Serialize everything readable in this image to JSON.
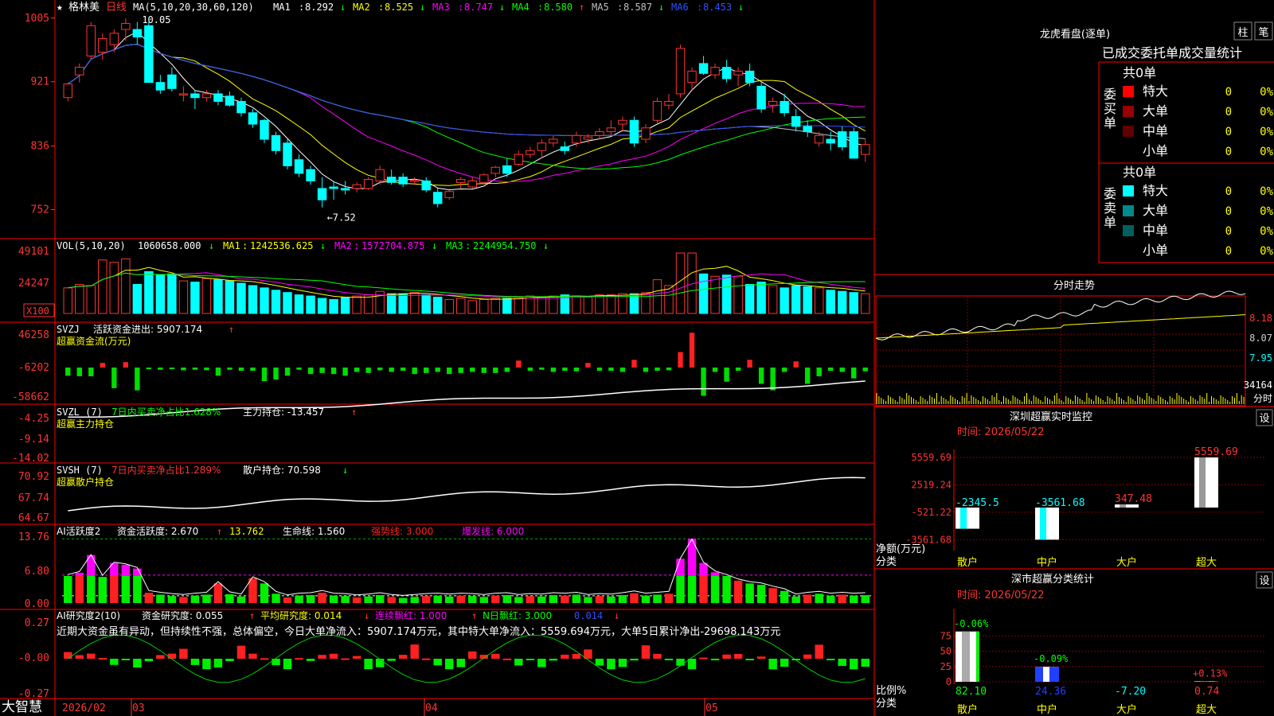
{
  "stock": {
    "star": "★",
    "name": "格林美",
    "period": "日线"
  },
  "ma_header": {
    "label": "MA(5,10,20,30,60,120)",
    "items": [
      {
        "name": "MA1",
        "value": "8.292",
        "arrow": "↓",
        "color": "#ffffff"
      },
      {
        "name": "MA2",
        "value": "8.525",
        "arrow": "↓",
        "color": "#ffff00"
      },
      {
        "name": "MA3",
        "value": "8.747",
        "arrow": "↓",
        "color": "#ff00ff"
      },
      {
        "name": "MA4",
        "value": "8.580",
        "arrow": "↑",
        "color": "#00ff00"
      },
      {
        "name": "MA5",
        "value": "8.587",
        "arrow": "↓",
        "color": "#c0c0c0"
      },
      {
        "name": "MA6",
        "value": "8.453",
        "arrow": "↓",
        "color": "#3050ff"
      }
    ]
  },
  "main_axis": {
    "ticks": [
      "1005",
      "921",
      "836",
      "752"
    ]
  },
  "main_annotations": {
    "high": "10.05",
    "low": "←7.52"
  },
  "vol": {
    "label": "VOL(5,10,20)",
    "value": "1060658.000",
    "arrow": "↓",
    "ma": [
      {
        "name": "MA1",
        "value": "1242536.625",
        "arrow": "↓",
        "color": "#ffff00"
      },
      {
        "name": "MA2",
        "value": "1572704.875",
        "arrow": "↓",
        "color": "#ff00ff"
      },
      {
        "name": "MA3",
        "value": "2244954.750",
        "arrow": "↓",
        "color": "#00ff00"
      }
    ],
    "ticks": [
      "49101",
      "24247"
    ],
    "unit": "X100"
  },
  "svzj": {
    "label": "SVZJ",
    "text": "活跃资金进出: 5907.174",
    "arrow": "↑",
    "sub": "超赢资金流(万元)",
    "ticks": [
      "46258",
      "-6202",
      "-58662"
    ]
  },
  "svzl": {
    "label": "SVZL (7)",
    "text1": "7日内买卖净占比1.628%",
    "text2": "主力持仓: -13.457",
    "arrow": "↑",
    "sub": "超赢主力持仓",
    "ticks": [
      "-4.25",
      "-9.14",
      "-14.02"
    ]
  },
  "svsh": {
    "label": "SVSH (7)",
    "text1": "7日内买卖净占比1.289%",
    "text2": "散户持仓: 70.598",
    "arrow": "↓",
    "sub": "超赢散户持仓",
    "ticks": [
      "70.92",
      "67.74",
      "64.67"
    ]
  },
  "ai2": {
    "label": "AI活跃度2",
    "t1": "资金活跃度: 2.670",
    "a1": "↑",
    "t2": "13.762",
    "t3": "生命线: 1.560",
    "t4": "强势线: 3.000",
    "t5": "爆发线: 6.000",
    "ticks": [
      "13.76",
      "6.80",
      "0.00"
    ]
  },
  "ai3": {
    "label": "AI研究度2(10)",
    "t1": "资金研究度: 0.055",
    "a1": "↑",
    "t2": "平均研究度: 0.014",
    "a2": "↓",
    "t3": "连续飘红: 1.000",
    "a3": "↑",
    "t4": "N日飘红: 3.000",
    "t5": "0.014",
    "a5": "↓",
    "ticks": [
      "0.27",
      "-0.00",
      "-0.27"
    ],
    "comment": "近期大资金虽有异动，但持续性不强，总体偏空，今日大单净流入：5907.174万元，其中特大单净流入：5559.694万元，大单5日累计净出-29698.143万元"
  },
  "x_axis": {
    "labels": [
      "2026/02",
      "03",
      "04",
      "05"
    ]
  },
  "brand": "大智慧",
  "longhu": {
    "title": "龙虎看盘(逐单)",
    "btn1": "柱",
    "btn2": "笔",
    "header": "已成交委托单成交量统计",
    "buy_label": "委买单",
    "sell_label": "委卖单",
    "buy_total": "共0单",
    "sell_total": "共0单",
    "buy_rows": [
      {
        "name": "特大",
        "count": "0",
        "pct": "0%",
        "color": "#ff0000"
      },
      {
        "name": "大单",
        "count": "0",
        "pct": "0%",
        "color": "#9a0000"
      },
      {
        "name": "中单",
        "count": "0",
        "pct": "0%",
        "color": "#600000"
      },
      {
        "name": "小单",
        "count": "0",
        "pct": "0%",
        "color": "#000000"
      }
    ],
    "sell_rows": [
      {
        "name": "特大",
        "count": "0",
        "pct": "0%",
        "color": "#00ffff"
      },
      {
        "name": "大单",
        "count": "0",
        "pct": "0%",
        "color": "#008b8b"
      },
      {
        "name": "中单",
        "count": "0",
        "pct": "0%",
        "color": "#006060"
      },
      {
        "name": "小单",
        "count": "0",
        "pct": "0%",
        "color": "#000000"
      }
    ]
  },
  "intraday": {
    "title": "分时走势",
    "ticks": [
      "8.18",
      "8.07",
      "7.95"
    ],
    "vol_label": "34164",
    "vol_unit": "分时"
  },
  "monitor": {
    "title": "深圳超赢实时监控",
    "btn": "设",
    "time": "时间: 2026/05/22",
    "ylabel": "净额(万元)",
    "xlabel": "分类"
  },
  "classify": {
    "title": "深市超赢分类统计",
    "btn": "设",
    "time": "时间: 2026/05/22",
    "ylabel": "比例%",
    "xlabel": "分类"
  },
  "chart_data": [
    {
      "type": "candlestick",
      "title": "格林美 日线",
      "ylim": [
        7.4,
        10.1
      ],
      "ohlc": [
        [
          9.0,
          9.2,
          8.95,
          9.18
        ],
        [
          9.3,
          9.45,
          9.2,
          9.4
        ],
        [
          9.55,
          10.0,
          9.5,
          9.95
        ],
        [
          9.6,
          9.85,
          9.5,
          9.78
        ],
        [
          9.7,
          9.9,
          9.6,
          9.85
        ],
        [
          9.9,
          10.05,
          9.75,
          9.98
        ],
        [
          9.9,
          10.0,
          9.7,
          9.8
        ],
        [
          9.95,
          10.0,
          9.2,
          9.2
        ],
        [
          9.2,
          9.3,
          9.05,
          9.1
        ],
        [
          9.3,
          9.4,
          9.08,
          9.12
        ],
        [
          9.05,
          9.15,
          8.95,
          9.05
        ],
        [
          9.05,
          9.1,
          8.85,
          9.0
        ],
        [
          9.0,
          9.1,
          8.95,
          9.05
        ],
        [
          9.05,
          9.1,
          8.9,
          8.95
        ],
        [
          9.02,
          9.08,
          8.88,
          8.9
        ],
        [
          8.95,
          9.0,
          8.75,
          8.8
        ],
        [
          8.8,
          8.85,
          8.6,
          8.65
        ],
        [
          8.7,
          8.72,
          8.4,
          8.45
        ],
        [
          8.5,
          8.55,
          8.25,
          8.3
        ],
        [
          8.4,
          8.45,
          8.05,
          8.1
        ],
        [
          8.18,
          8.25,
          7.95,
          8.0
        ],
        [
          8.05,
          8.1,
          7.85,
          7.9
        ],
        [
          7.8,
          7.95,
          7.55,
          7.65
        ],
        [
          7.82,
          7.9,
          7.65,
          7.8
        ],
        [
          7.8,
          7.9,
          7.72,
          7.78
        ],
        [
          7.8,
          7.88,
          7.75,
          7.85
        ],
        [
          7.8,
          7.95,
          7.78,
          7.92
        ],
        [
          7.9,
          8.1,
          7.85,
          8.05
        ],
        [
          7.95,
          8.05,
          7.85,
          7.88
        ],
        [
          7.95,
          8.0,
          7.82,
          7.86
        ],
        [
          7.9,
          7.95,
          7.85,
          7.91
        ],
        [
          7.9,
          7.95,
          7.75,
          7.78
        ],
        [
          7.75,
          7.8,
          7.55,
          7.6
        ],
        [
          7.68,
          7.8,
          7.65,
          7.76
        ],
        [
          7.88,
          7.95,
          7.8,
          7.92
        ],
        [
          7.82,
          7.95,
          7.8,
          7.9
        ],
        [
          7.88,
          8.0,
          7.85,
          7.98
        ],
        [
          8.0,
          8.1,
          7.95,
          8.08
        ],
        [
          8.1,
          8.2,
          7.95,
          8.0
        ],
        [
          8.12,
          8.3,
          8.1,
          8.25
        ],
        [
          8.25,
          8.35,
          8.2,
          8.3
        ],
        [
          8.3,
          8.45,
          8.2,
          8.4
        ],
        [
          8.4,
          8.5,
          8.35,
          8.45
        ],
        [
          8.35,
          8.42,
          8.25,
          8.3
        ],
        [
          8.4,
          8.55,
          8.35,
          8.5
        ],
        [
          8.45,
          8.52,
          8.4,
          8.48
        ],
        [
          8.5,
          8.6,
          8.45,
          8.55
        ],
        [
          8.55,
          8.7,
          8.5,
          8.6
        ],
        [
          8.65,
          8.75,
          8.55,
          8.7
        ],
        [
          8.7,
          8.75,
          8.35,
          8.4
        ],
        [
          8.45,
          8.65,
          8.4,
          8.6
        ],
        [
          8.7,
          9.0,
          8.65,
          8.95
        ],
        [
          8.9,
          9.05,
          8.85,
          8.95
        ],
        [
          9.05,
          9.7,
          9.0,
          9.65
        ],
        [
          9.2,
          9.4,
          9.1,
          9.35
        ],
        [
          9.45,
          9.55,
          9.3,
          9.32
        ],
        [
          9.3,
          9.45,
          9.25,
          9.4
        ],
        [
          9.4,
          9.5,
          9.2,
          9.25
        ],
        [
          9.3,
          9.4,
          9.15,
          9.35
        ],
        [
          9.35,
          9.45,
          9.15,
          9.2
        ],
        [
          9.15,
          9.2,
          8.8,
          8.85
        ],
        [
          8.9,
          9.0,
          8.8,
          8.95
        ],
        [
          8.95,
          9.05,
          8.75,
          8.8
        ],
        [
          8.75,
          8.85,
          8.55,
          8.62
        ],
        [
          8.62,
          8.7,
          8.48,
          8.55
        ],
        [
          8.4,
          8.55,
          8.35,
          8.5
        ],
        [
          8.45,
          8.55,
          8.3,
          8.4
        ],
        [
          8.55,
          8.62,
          8.3,
          8.35
        ],
        [
          8.55,
          8.6,
          8.2,
          8.2
        ],
        [
          8.25,
          8.45,
          8.15,
          8.38
        ]
      ]
    },
    {
      "type": "bar",
      "title": "VOL(5,10,20)",
      "ylim": [
        0,
        52000
      ],
      "values": [
        22000,
        25000,
        24000,
        46000,
        44000,
        47000,
        25000,
        36000,
        33000,
        34000,
        28000,
        27000,
        30000,
        29000,
        28000,
        26000,
        24000,
        22000,
        20000,
        18000,
        16000,
        15000,
        13000,
        12000,
        14000,
        15000,
        16000,
        19000,
        17000,
        17000,
        18000,
        16000,
        14000,
        12000,
        13000,
        11000,
        12000,
        13000,
        13000,
        14000,
        15000,
        14000,
        15000,
        16000,
        15000,
        14000,
        16000,
        16000,
        17000,
        17000,
        18000,
        29000,
        24000,
        52000,
        52000,
        34000,
        32000,
        33000,
        32000,
        25000,
        27000,
        24000,
        22000,
        24000,
        23000,
        22000,
        20000,
        19000,
        18000,
        17000
      ]
    },
    {
      "type": "bar",
      "title": "SVZJ",
      "ylim": [
        -58662,
        46258
      ],
      "values": [
        -15000,
        -16000,
        -16000,
        6000,
        -38000,
        7000,
        -42000,
        -3000,
        -4000,
        -3000,
        -5000,
        -4000,
        -5000,
        -15000,
        -4000,
        -6000,
        -6000,
        -25000,
        -22000,
        -15000,
        -4000,
        -12000,
        -10000,
        -12000,
        -15000,
        -8000,
        -10000,
        -5000,
        -8000,
        -6000,
        -12000,
        -10000,
        -8000,
        -12000,
        -10000,
        -8000,
        -10000,
        -10000,
        -8000,
        9000,
        -6000,
        -4000,
        -8000,
        -6000,
        -7000,
        6000,
        -6000,
        -6000,
        -8000,
        10000,
        -8000,
        -6000,
        -5000,
        20000,
        45000,
        -52000,
        -8000,
        -26000,
        -6000,
        10000,
        -30000,
        -42000,
        -8000,
        8000,
        -30000,
        -16000,
        -6000,
        -8000,
        -20000,
        -7000
      ]
    },
    {
      "type": "bar",
      "title": "AI活跃度2",
      "ylim": [
        0,
        14.5
      ],
      "values": [
        5.8,
        6.5,
        10.3,
        5.6,
        8.6,
        8.2,
        7.4,
        2.2,
        1.8,
        1.5,
        1.3,
        1.6,
        1.8,
        4.2,
        1.9,
        1.4,
        5.3,
        4.2,
        2.0,
        1.2,
        1.6,
        1.7,
        2.2,
        1.6,
        1.5,
        1.2,
        1.4,
        1.7,
        1.3,
        1.1,
        1.3,
        1.5,
        1.6,
        1.4,
        1.6,
        1.5,
        1.3,
        1.6,
        1.7,
        1.3,
        1.5,
        1.4,
        1.7,
        1.6,
        1.8,
        1.3,
        1.5,
        1.4,
        1.7,
        2.1,
        1.6,
        1.8,
        2.0,
        9.5,
        13.8,
        8.6,
        6.6,
        5.8,
        4.8,
        4.2,
        3.9,
        3.2,
        2.6,
        1.4,
        1.8,
        2.0,
        1.6,
        1.8,
        1.6,
        1.7
      ]
    }
  ]
}
